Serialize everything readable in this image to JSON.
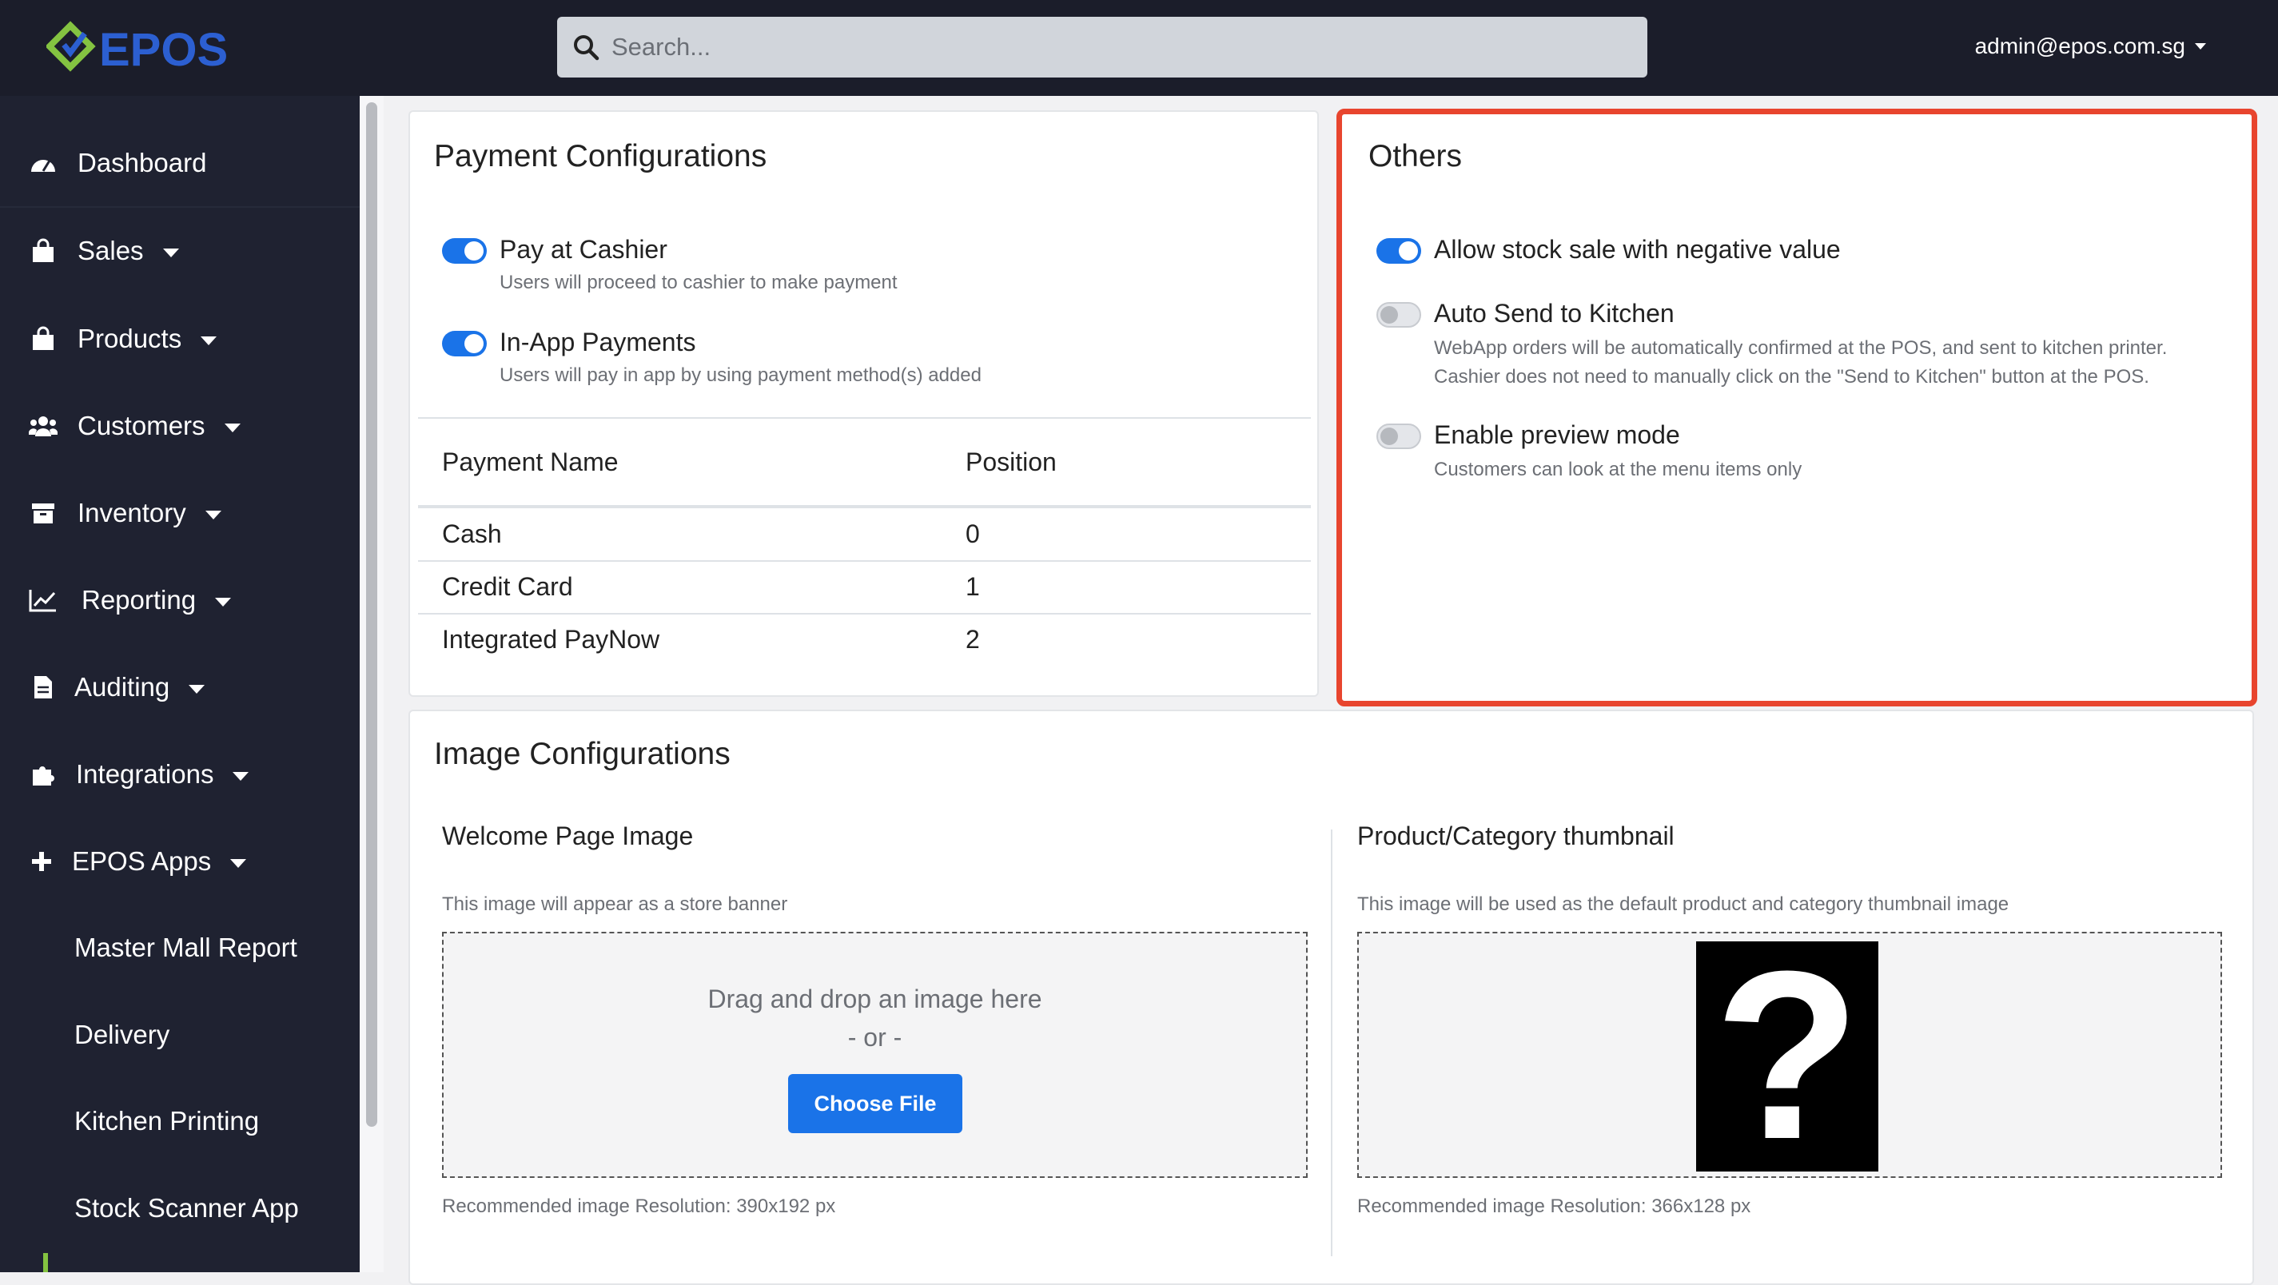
{
  "header": {
    "logo_text": "EPOS",
    "search_placeholder": "Search...",
    "user_email": "admin@epos.com.sg",
    "accent_color": "#1a73e8",
    "logo_green": "#84c341",
    "logo_blue": "#2c5fd1"
  },
  "sidebar": {
    "items": [
      {
        "label": "Dashboard",
        "icon": "tachometer-icon",
        "has_caret": false
      },
      {
        "label": "Sales",
        "icon": "shopping-bag-icon",
        "has_caret": true
      },
      {
        "label": "Products",
        "icon": "shopping-bag-icon",
        "has_caret": true
      },
      {
        "label": "Customers",
        "icon": "users-icon",
        "has_caret": true
      },
      {
        "label": "Inventory",
        "icon": "archive-icon",
        "has_caret": true
      },
      {
        "label": "Reporting",
        "icon": "chart-line-icon",
        "has_caret": true
      },
      {
        "label": "Auditing",
        "icon": "file-icon",
        "has_caret": true
      },
      {
        "label": "Integrations",
        "icon": "puzzle-icon",
        "has_caret": true
      },
      {
        "label": "EPOS Apps",
        "icon": "plus-icon",
        "has_caret": true
      }
    ],
    "sub_items": [
      "Master Mall Report",
      "Delivery",
      "Kitchen Printing",
      "Stock Scanner App"
    ]
  },
  "payment": {
    "title": "Payment Configurations",
    "options": [
      {
        "label": "Pay at Cashier",
        "desc": "Users will proceed to cashier to make payment",
        "enabled": true
      },
      {
        "label": "In-App Payments",
        "desc": "Users will pay in app by using payment method(s) added",
        "enabled": true
      }
    ],
    "table": {
      "headers": [
        "Payment Name",
        "Position"
      ],
      "rows": [
        [
          "Cash",
          "0"
        ],
        [
          "Credit Card",
          "1"
        ],
        [
          "Integrated PayNow",
          "2"
        ]
      ]
    }
  },
  "others": {
    "title": "Others",
    "options": [
      {
        "label": "Allow stock sale with negative value",
        "desc": "",
        "enabled": true
      },
      {
        "label": "Auto Send to Kitchen",
        "desc": "WebApp orders will be automatically confirmed at the POS, and sent to kitchen printer.",
        "desc2": "Cashier does not need to manually click on the \"Send to Kitchen\" button at the POS.",
        "enabled": false
      },
      {
        "label": "Enable preview mode",
        "desc": "Customers can look at the menu items only",
        "enabled": false
      }
    ]
  },
  "images": {
    "title": "Image Configurations",
    "welcome": {
      "title": "Welcome Page Image",
      "hint": "This image will appear as a store banner",
      "drag_text": "Drag and drop an image here",
      "or_text": "- or -",
      "button": "Choose File",
      "resolution": "Recommended image Resolution: 390x192 px"
    },
    "thumbnail": {
      "title": "Product/Category thumbnail",
      "hint": "This image will be used as the default product and category thumbnail image",
      "placeholder_glyph": "?",
      "resolution": "Recommended image Resolution: 366x128 px"
    }
  }
}
